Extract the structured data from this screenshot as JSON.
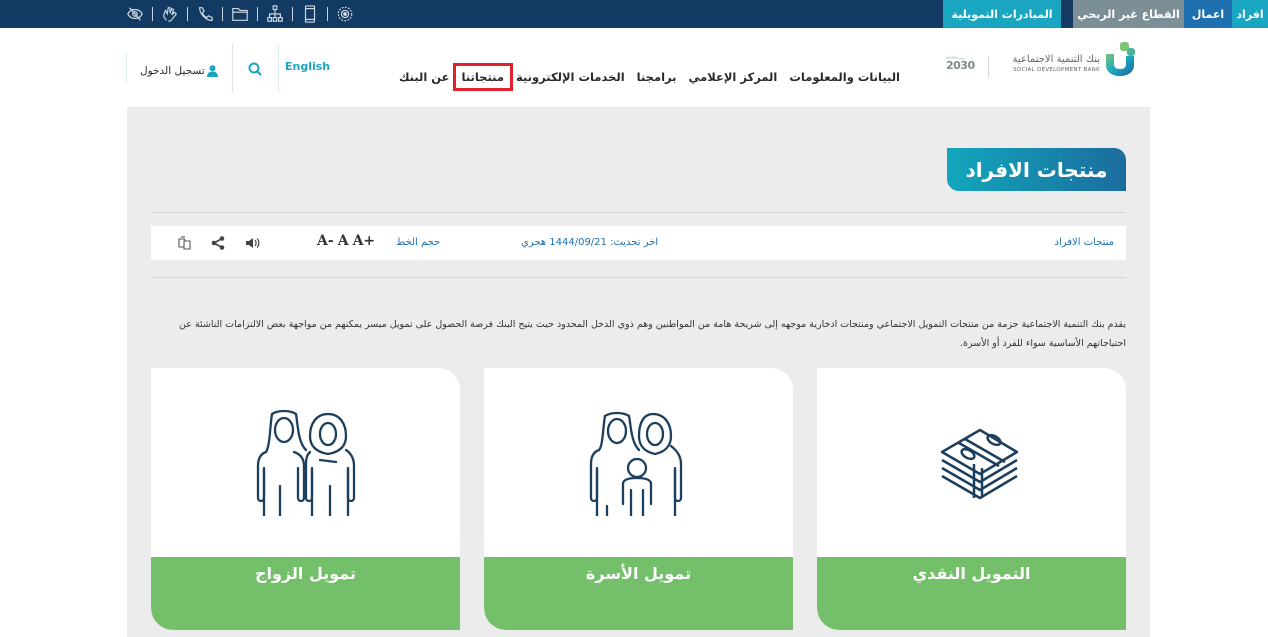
{
  "topbar": {
    "accessibility_icons": [
      "eye-slash-icon",
      "sign-language-icon",
      "phone-icon",
      "folder-icon",
      "sitemap-icon",
      "mobile-icon",
      "settings-badge-icon"
    ],
    "tabs": [
      {
        "label": "افراد",
        "color": "#1aa6c1"
      },
      {
        "label": "اعمال",
        "color": "#1d6fad"
      },
      {
        "label": "القطاع غير الربحي",
        "color": "#7d8f96"
      },
      {
        "label": "المبادرات التمويلية",
        "color": "#1aa6c1"
      }
    ]
  },
  "header": {
    "logo_ar": "بنك التنمية الاجتماعية",
    "logo_en": "SOCIAL DEVELOPMENT BANK",
    "vision_label": "2030",
    "vision_small": "VISION رؤية",
    "nav": [
      {
        "label": "عن البنك",
        "active": false
      },
      {
        "label": "منتجاتنا",
        "active": true
      },
      {
        "label": "الخدمات الإلكترونية",
        "active": false
      },
      {
        "label": "برامجنا",
        "active": false
      },
      {
        "label": "المركز الإعلامي",
        "active": false
      },
      {
        "label": "البيانات والمعلومات",
        "active": false
      }
    ],
    "language_link": "English",
    "login_label": "تسجيل الدخول"
  },
  "page": {
    "title": "منتجات الافراد",
    "breadcrumb": "منتجات الافراد",
    "last_updated": "اخر تحديث: 1444/09/21 هجري",
    "font_size_label": "حجم الخط",
    "font_controls": [
      "A+",
      "A",
      "A-"
    ],
    "description": "يقدم بنك التنمية الاجتماعية حزمة من منتجات التمويل الاجتماعي ومنتجات ادخارية موجهه إلى شريحة هامة من المواطنين وهم ذوي الدخل المحدود حيث يتيح البنك فرصة الحصول على تمويل ميسر يمكنهم من مواجهة بعض الالتزامات الناشئة عن احتياجاتهم الأساسية سواء للفرد أو الأسرة."
  },
  "cards": [
    {
      "label": "التمويل النقدي",
      "icon": "money-stack-icon"
    },
    {
      "label": "تمويل الأسرة",
      "icon": "family-icon"
    },
    {
      "label": "تمويل الزواج",
      "icon": "couple-icon"
    }
  ],
  "colors": {
    "topbar": "#123a63",
    "accent_cyan": "#1aa6c1",
    "accent_blue": "#1d6fad",
    "card_green": "#74c06a",
    "highlight_red": "#e0202a"
  }
}
